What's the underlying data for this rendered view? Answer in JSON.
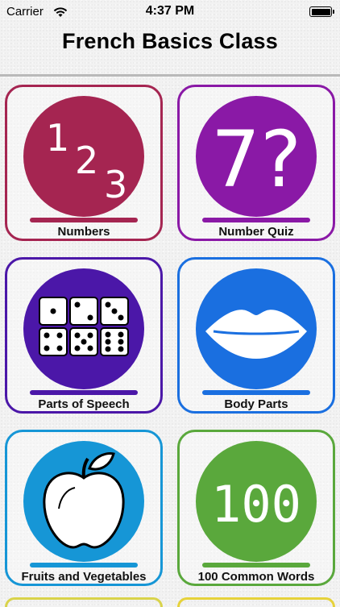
{
  "status_bar": {
    "carrier": "Carrier",
    "time": "4:37 PM"
  },
  "nav": {
    "title": "French Basics Class"
  },
  "cards": [
    {
      "label": "Numbers",
      "color": "#a52551",
      "icon": "numbers-123-icon",
      "glyphs": [
        "1",
        "2",
        "3"
      ]
    },
    {
      "label": "Number Quiz",
      "color": "#8a19a6",
      "icon": "number-quiz-icon",
      "glyphs": [
        "7?"
      ]
    },
    {
      "label": "Parts of Speech",
      "color": "#4b17a8",
      "icon": "dice-icon"
    },
    {
      "label": "Body Parts",
      "color": "#1a6fe0",
      "icon": "lips-icon"
    },
    {
      "label": "Fruits and Vegetables",
      "color": "#1696d6",
      "icon": "apple-icon"
    },
    {
      "label": "100 Common Words",
      "color": "#5aa83c",
      "icon": "hundred-icon",
      "glyphs": [
        "100"
      ]
    }
  ],
  "partial_cards_colors": [
    "#d9d34a",
    "#e6d23a"
  ]
}
